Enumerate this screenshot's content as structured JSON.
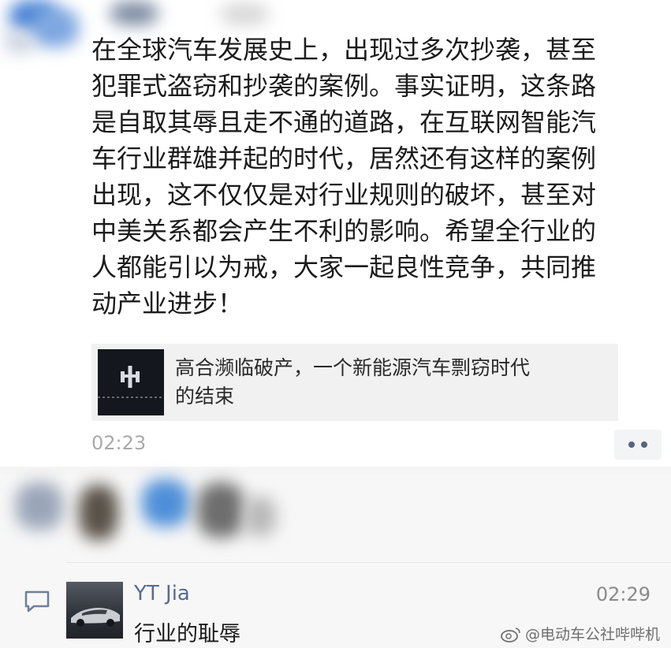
{
  "post": {
    "lines": [
      "在全球汽车发展史上，出现过多次抄袭，甚至",
      "犯罪式盗窃和抄袭的案例。事实证明，这条路",
      "是自取其辱且走不通的道路，在互联网智能汽",
      "车行业群雄并起的时代，居然还有这样的案例",
      "出现，这不仅仅是对行业规则的破坏，甚至对",
      "中美关系都会产生不利的影响。希望全行业的",
      "人都能引以为戒，大家一起良性竞争，共同推",
      "动产业进步！"
    ],
    "link_card": {
      "title_line1": "高合濒临破产，一个新能源汽车剽窃时代",
      "title_line2": "的结束"
    },
    "timestamp": "02:23"
  },
  "comment": {
    "author": "YT Jia",
    "time": "02:29",
    "text": "行业的耻辱"
  },
  "watermark": {
    "text": "@电动车公社哔哔机"
  },
  "icons": {
    "more": "more-dots-icon",
    "comment": "comment-bubble-icon",
    "weibo": "weibo-logo-icon"
  },
  "colors": {
    "name_link": "#576b95",
    "timestamp": "#a9a9a9",
    "card_bg": "#f1f1f1"
  }
}
